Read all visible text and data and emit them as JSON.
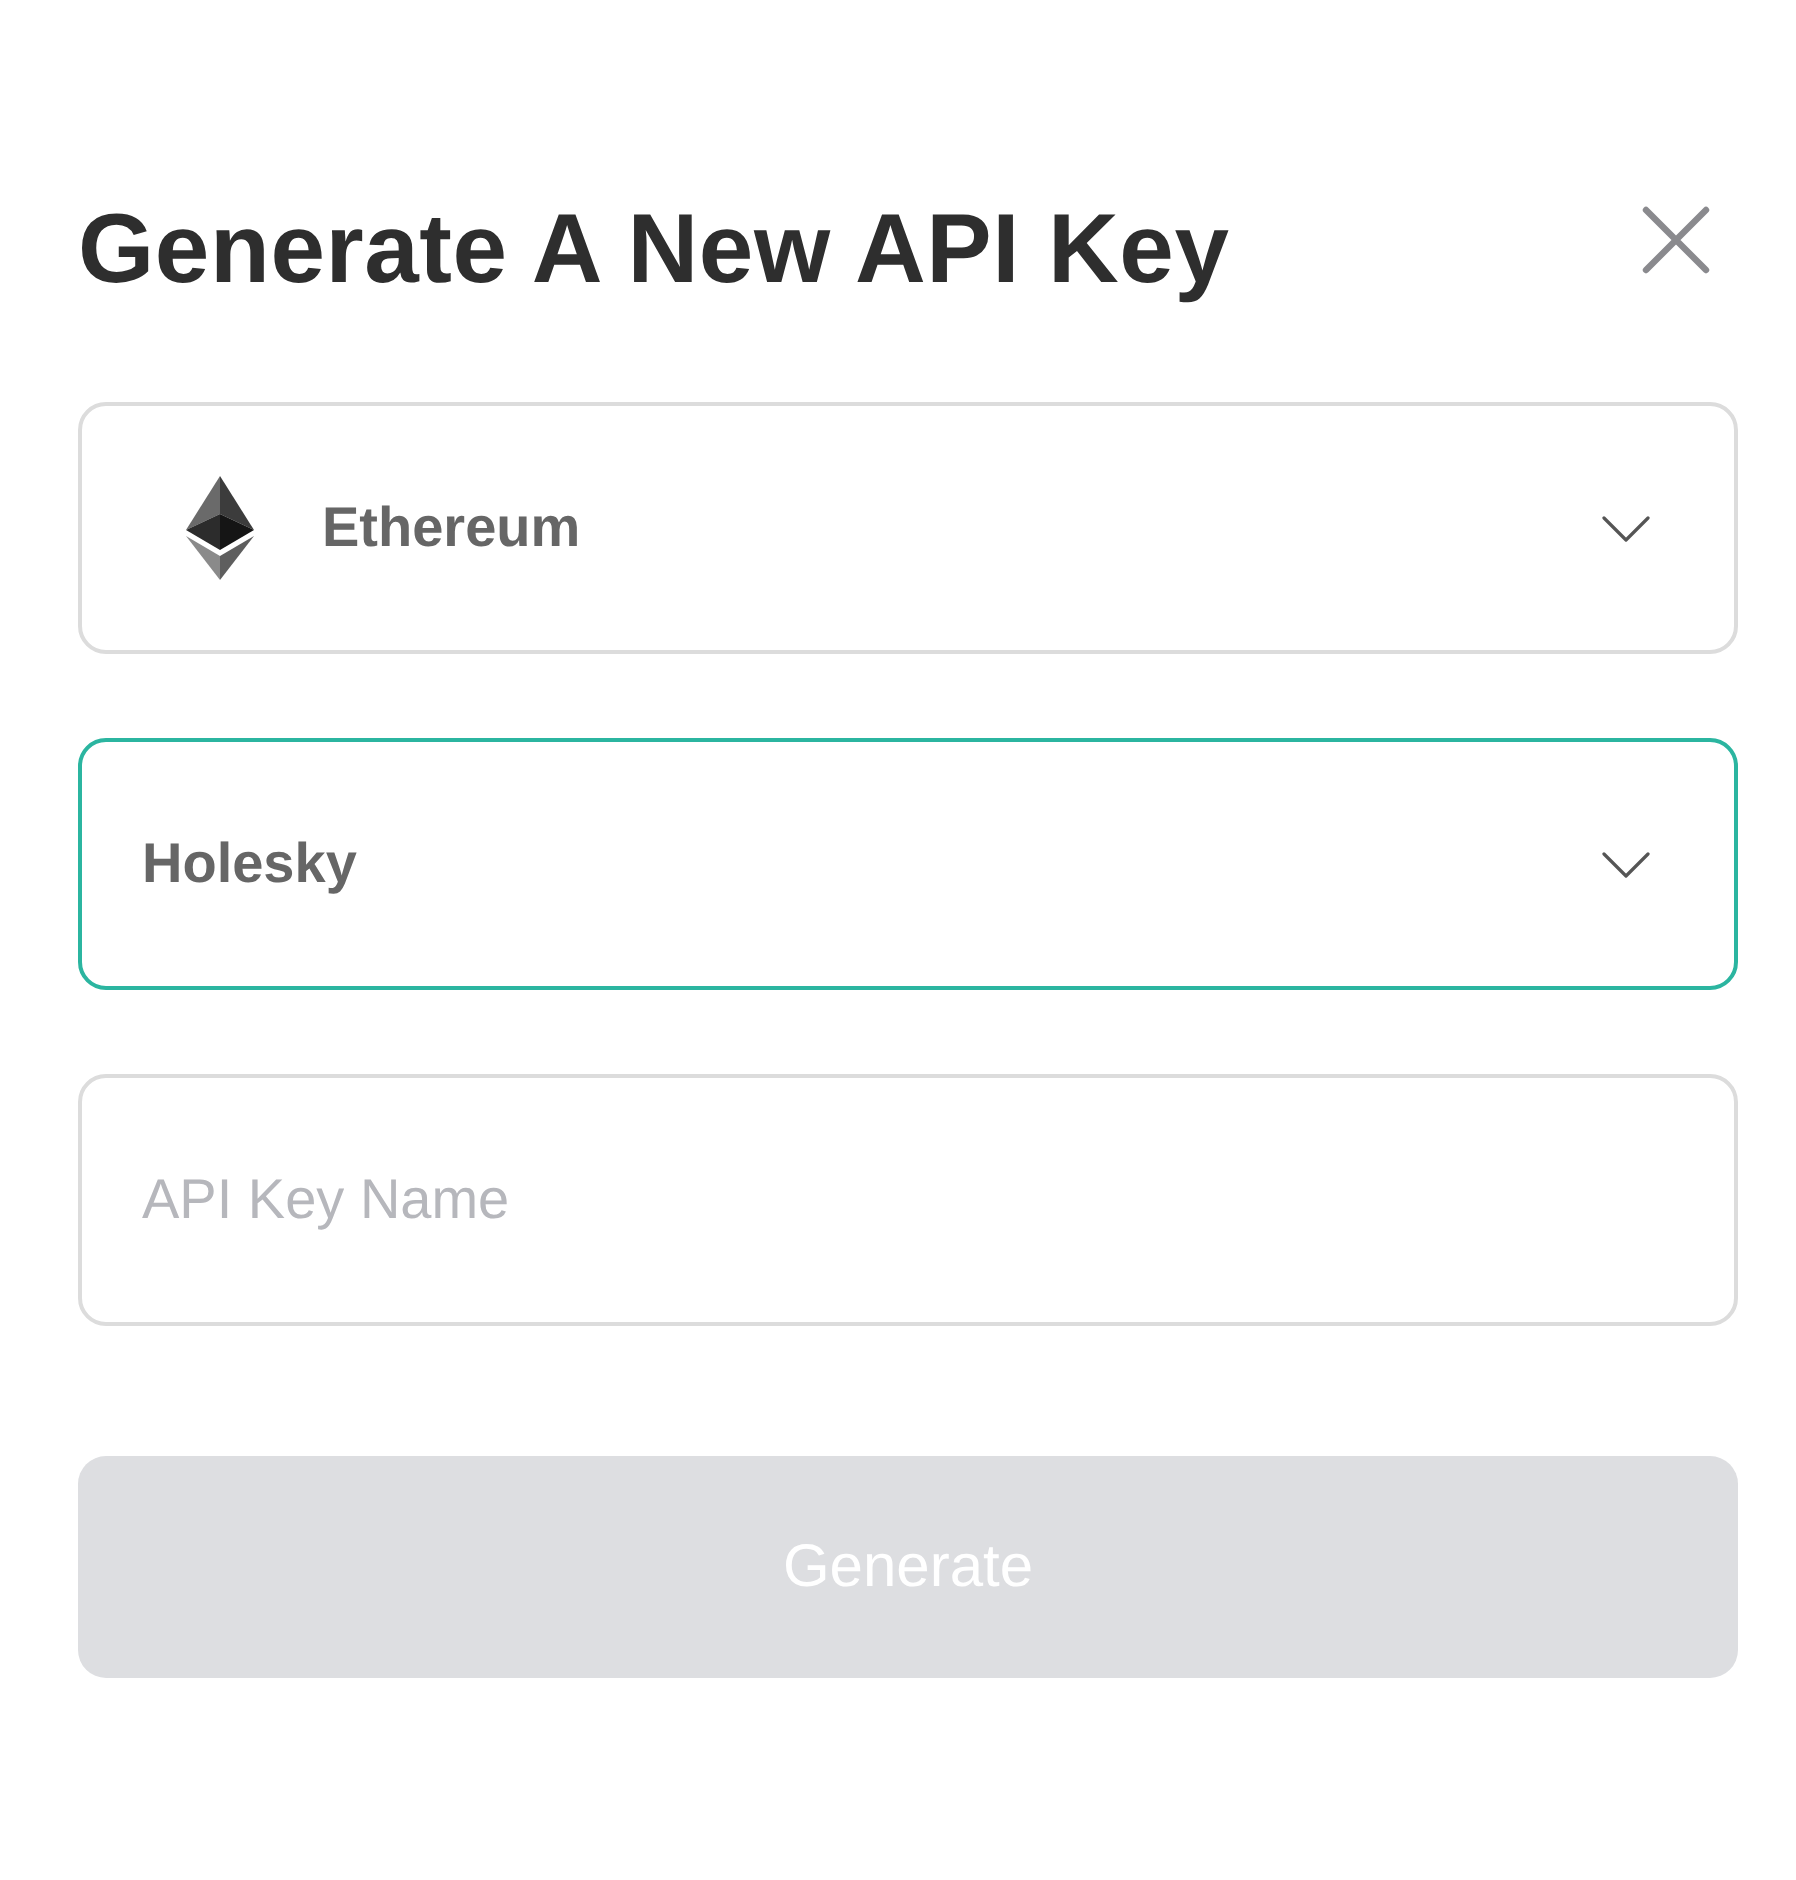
{
  "dialog": {
    "title": "Generate A New API Key",
    "chain_select": {
      "value": "Ethereum",
      "focused": false
    },
    "network_select": {
      "value": "Holesky",
      "focused": true
    },
    "name_field": {
      "placeholder": "API Key Name",
      "focused": false
    },
    "generate_button": {
      "label": "Generate",
      "disabled": true
    }
  }
}
